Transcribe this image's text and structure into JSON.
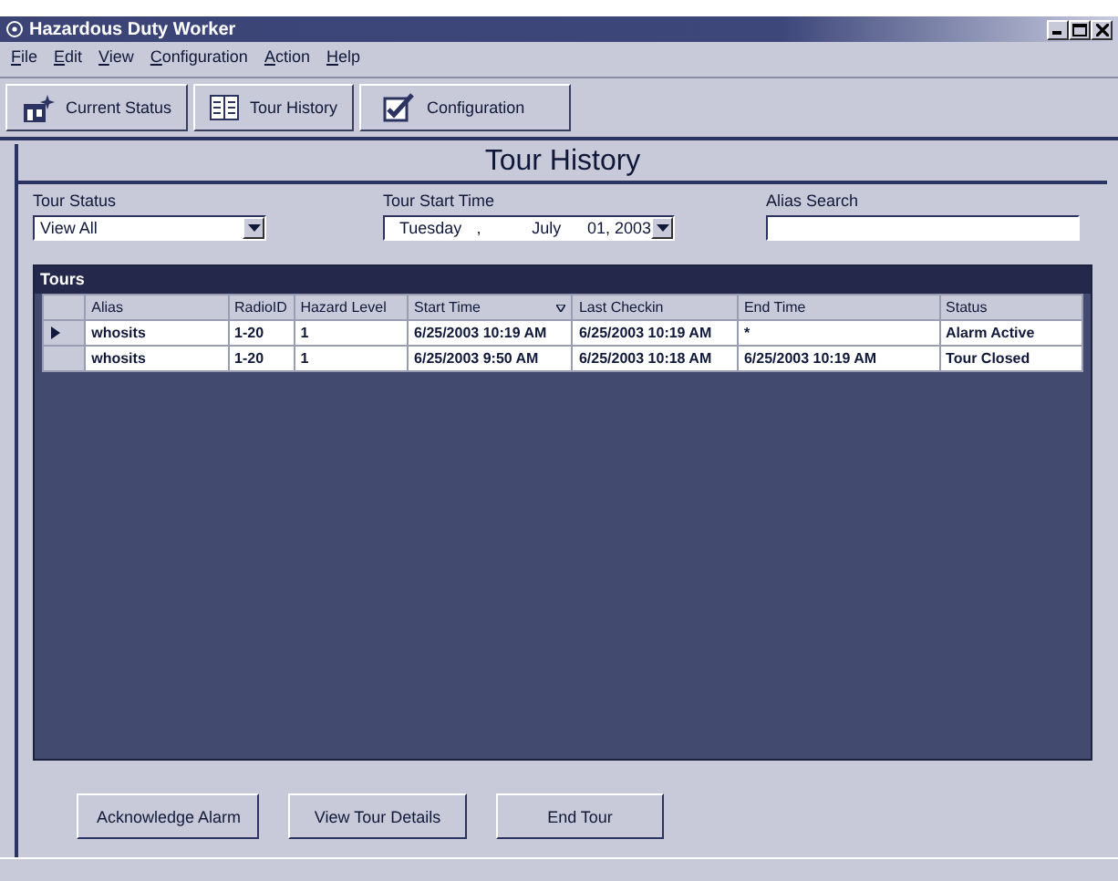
{
  "window": {
    "title": "Hazardous Duty Worker"
  },
  "menu": [
    "File",
    "Edit",
    "View",
    "Configuration",
    "Action",
    "Help"
  ],
  "toolbar": [
    {
      "label": "Current Status",
      "kind": "status"
    },
    {
      "label": "Tour History",
      "kind": "history"
    },
    {
      "label": "Configuration",
      "kind": "config"
    }
  ],
  "heading": "Tour History",
  "filters": {
    "tour_status": {
      "label": "Tour Status",
      "value": "View All"
    },
    "tour_start_time": {
      "label": "Tour Start Time",
      "parts": [
        "Tuesday",
        ",",
        "July",
        "01, 2003"
      ]
    },
    "alias_search": {
      "label": "Alias Search"
    }
  },
  "table": {
    "title": "Tours",
    "columns": [
      {
        "label": "Alias",
        "sorted": false
      },
      {
        "label": "RadioID",
        "sorted": false
      },
      {
        "label": "Hazard Level",
        "sorted": false
      },
      {
        "label": "Start Time",
        "sorted": true
      },
      {
        "label": "Last Checkin",
        "sorted": false
      },
      {
        "label": "End Time",
        "sorted": false
      },
      {
        "label": "Status",
        "sorted": false
      }
    ],
    "rows": [
      {
        "current": true,
        "cells": [
          "whosits",
          "1-20",
          "1",
          "6/25/2003 10:19 AM",
          "6/25/2003 10:19 AM",
          "*",
          "Alarm Active"
        ]
      },
      {
        "current": false,
        "cells": [
          "whosits",
          "1-20",
          "1",
          "6/25/2003 9:50 AM",
          "6/25/2003 10:18 AM",
          "6/25/2003 10:19 AM",
          "Tour Closed"
        ]
      }
    ]
  },
  "buttons": [
    "Acknowledge Alarm",
    "View Tour Details",
    "End Tour"
  ]
}
